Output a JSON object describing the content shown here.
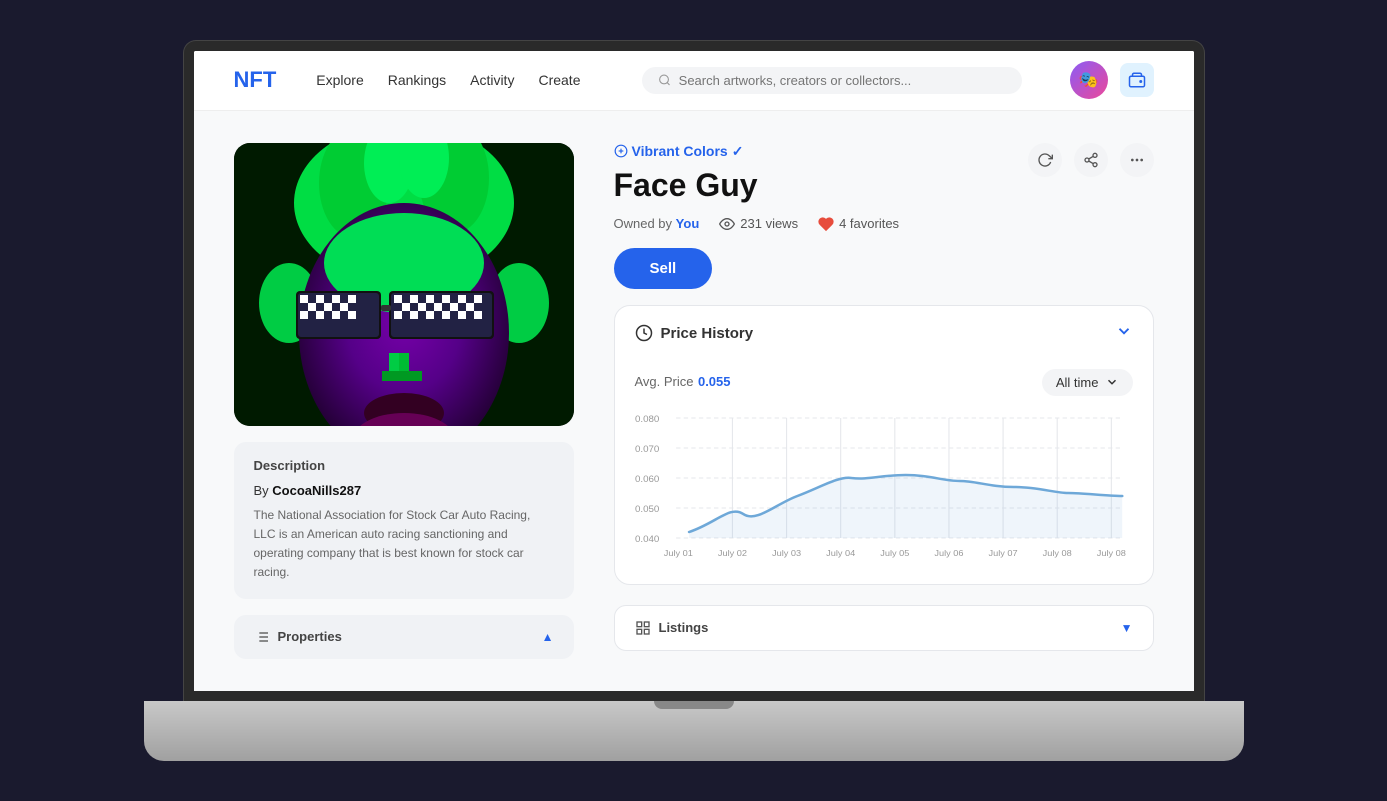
{
  "nav": {
    "logo": "NFT",
    "links": [
      "Explore",
      "Rankings",
      "Activity",
      "Create"
    ],
    "search_placeholder": "Search artworks, creators or collectors..."
  },
  "nft": {
    "collection": "Vibrant Colors",
    "title": "Face Guy",
    "owned_label": "Owned by",
    "owner": "You",
    "views": "231 views",
    "favorites": "4 favorites",
    "sell_label": "Sell"
  },
  "description": {
    "section_title": "Description",
    "by_label": "By",
    "author": "CocoaNills287",
    "text": "The National Association for Stock Car Auto Racing, LLC is an American auto racing sanctioning and operating company that is best known for stock car racing."
  },
  "price_history": {
    "title": "Price History",
    "avg_label": "Avg. Price",
    "avg_value": "0.055",
    "time_filter": "All time",
    "y_labels": [
      "0.080",
      "0.070",
      "0.060",
      "0.050",
      "0.040"
    ],
    "x_labels": [
      "July 01",
      "July 02",
      "July 03",
      "July 04",
      "July 05",
      "July 06",
      "July 07",
      "July 08",
      "July 08"
    ],
    "chart_data": [
      {
        "x": 0,
        "y": 0.042
      },
      {
        "x": 1,
        "y": 0.048
      },
      {
        "x": 2,
        "y": 0.054
      },
      {
        "x": 3,
        "y": 0.06
      },
      {
        "x": 4,
        "y": 0.061
      },
      {
        "x": 5,
        "y": 0.059
      },
      {
        "x": 6,
        "y": 0.057
      },
      {
        "x": 7,
        "y": 0.055
      },
      {
        "x": 8,
        "y": 0.054
      }
    ]
  },
  "properties": {
    "label": "Properties",
    "chevron": "▲"
  },
  "listings": {
    "label": "Listings",
    "chevron": "▼"
  },
  "colors": {
    "accent": "#2563eb",
    "bg_card": "#f0f2f5",
    "chart_line": "#6ea8d8"
  }
}
